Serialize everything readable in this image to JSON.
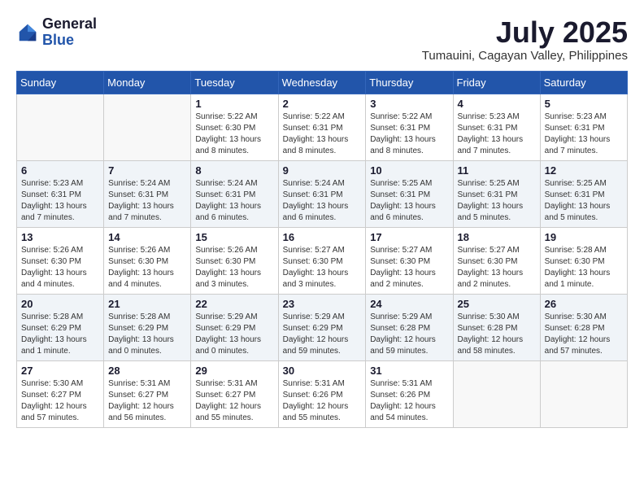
{
  "header": {
    "logo": {
      "general": "General",
      "blue": "Blue"
    },
    "title": "July 2025",
    "location": "Tumauini, Cagayan Valley, Philippines"
  },
  "weekdays": [
    "Sunday",
    "Monday",
    "Tuesday",
    "Wednesday",
    "Thursday",
    "Friday",
    "Saturday"
  ],
  "weeks": [
    [
      {
        "day": "",
        "sunrise": "",
        "sunset": "",
        "daylight": ""
      },
      {
        "day": "",
        "sunrise": "",
        "sunset": "",
        "daylight": ""
      },
      {
        "day": "1",
        "sunrise": "Sunrise: 5:22 AM",
        "sunset": "Sunset: 6:30 PM",
        "daylight": "Daylight: 13 hours and 8 minutes."
      },
      {
        "day": "2",
        "sunrise": "Sunrise: 5:22 AM",
        "sunset": "Sunset: 6:31 PM",
        "daylight": "Daylight: 13 hours and 8 minutes."
      },
      {
        "day": "3",
        "sunrise": "Sunrise: 5:22 AM",
        "sunset": "Sunset: 6:31 PM",
        "daylight": "Daylight: 13 hours and 8 minutes."
      },
      {
        "day": "4",
        "sunrise": "Sunrise: 5:23 AM",
        "sunset": "Sunset: 6:31 PM",
        "daylight": "Daylight: 13 hours and 7 minutes."
      },
      {
        "day": "5",
        "sunrise": "Sunrise: 5:23 AM",
        "sunset": "Sunset: 6:31 PM",
        "daylight": "Daylight: 13 hours and 7 minutes."
      }
    ],
    [
      {
        "day": "6",
        "sunrise": "Sunrise: 5:23 AM",
        "sunset": "Sunset: 6:31 PM",
        "daylight": "Daylight: 13 hours and 7 minutes."
      },
      {
        "day": "7",
        "sunrise": "Sunrise: 5:24 AM",
        "sunset": "Sunset: 6:31 PM",
        "daylight": "Daylight: 13 hours and 7 minutes."
      },
      {
        "day": "8",
        "sunrise": "Sunrise: 5:24 AM",
        "sunset": "Sunset: 6:31 PM",
        "daylight": "Daylight: 13 hours and 6 minutes."
      },
      {
        "day": "9",
        "sunrise": "Sunrise: 5:24 AM",
        "sunset": "Sunset: 6:31 PM",
        "daylight": "Daylight: 13 hours and 6 minutes."
      },
      {
        "day": "10",
        "sunrise": "Sunrise: 5:25 AM",
        "sunset": "Sunset: 6:31 PM",
        "daylight": "Daylight: 13 hours and 6 minutes."
      },
      {
        "day": "11",
        "sunrise": "Sunrise: 5:25 AM",
        "sunset": "Sunset: 6:31 PM",
        "daylight": "Daylight: 13 hours and 5 minutes."
      },
      {
        "day": "12",
        "sunrise": "Sunrise: 5:25 AM",
        "sunset": "Sunset: 6:31 PM",
        "daylight": "Daylight: 13 hours and 5 minutes."
      }
    ],
    [
      {
        "day": "13",
        "sunrise": "Sunrise: 5:26 AM",
        "sunset": "Sunset: 6:30 PM",
        "daylight": "Daylight: 13 hours and 4 minutes."
      },
      {
        "day": "14",
        "sunrise": "Sunrise: 5:26 AM",
        "sunset": "Sunset: 6:30 PM",
        "daylight": "Daylight: 13 hours and 4 minutes."
      },
      {
        "day": "15",
        "sunrise": "Sunrise: 5:26 AM",
        "sunset": "Sunset: 6:30 PM",
        "daylight": "Daylight: 13 hours and 3 minutes."
      },
      {
        "day": "16",
        "sunrise": "Sunrise: 5:27 AM",
        "sunset": "Sunset: 6:30 PM",
        "daylight": "Daylight: 13 hours and 3 minutes."
      },
      {
        "day": "17",
        "sunrise": "Sunrise: 5:27 AM",
        "sunset": "Sunset: 6:30 PM",
        "daylight": "Daylight: 13 hours and 2 minutes."
      },
      {
        "day": "18",
        "sunrise": "Sunrise: 5:27 AM",
        "sunset": "Sunset: 6:30 PM",
        "daylight": "Daylight: 13 hours and 2 minutes."
      },
      {
        "day": "19",
        "sunrise": "Sunrise: 5:28 AM",
        "sunset": "Sunset: 6:30 PM",
        "daylight": "Daylight: 13 hours and 1 minute."
      }
    ],
    [
      {
        "day": "20",
        "sunrise": "Sunrise: 5:28 AM",
        "sunset": "Sunset: 6:29 PM",
        "daylight": "Daylight: 13 hours and 1 minute."
      },
      {
        "day": "21",
        "sunrise": "Sunrise: 5:28 AM",
        "sunset": "Sunset: 6:29 PM",
        "daylight": "Daylight: 13 hours and 0 minutes."
      },
      {
        "day": "22",
        "sunrise": "Sunrise: 5:29 AM",
        "sunset": "Sunset: 6:29 PM",
        "daylight": "Daylight: 13 hours and 0 minutes."
      },
      {
        "day": "23",
        "sunrise": "Sunrise: 5:29 AM",
        "sunset": "Sunset: 6:29 PM",
        "daylight": "Daylight: 12 hours and 59 minutes."
      },
      {
        "day": "24",
        "sunrise": "Sunrise: 5:29 AM",
        "sunset": "Sunset: 6:28 PM",
        "daylight": "Daylight: 12 hours and 59 minutes."
      },
      {
        "day": "25",
        "sunrise": "Sunrise: 5:30 AM",
        "sunset": "Sunset: 6:28 PM",
        "daylight": "Daylight: 12 hours and 58 minutes."
      },
      {
        "day": "26",
        "sunrise": "Sunrise: 5:30 AM",
        "sunset": "Sunset: 6:28 PM",
        "daylight": "Daylight: 12 hours and 57 minutes."
      }
    ],
    [
      {
        "day": "27",
        "sunrise": "Sunrise: 5:30 AM",
        "sunset": "Sunset: 6:27 PM",
        "daylight": "Daylight: 12 hours and 57 minutes."
      },
      {
        "day": "28",
        "sunrise": "Sunrise: 5:31 AM",
        "sunset": "Sunset: 6:27 PM",
        "daylight": "Daylight: 12 hours and 56 minutes."
      },
      {
        "day": "29",
        "sunrise": "Sunrise: 5:31 AM",
        "sunset": "Sunset: 6:27 PM",
        "daylight": "Daylight: 12 hours and 55 minutes."
      },
      {
        "day": "30",
        "sunrise": "Sunrise: 5:31 AM",
        "sunset": "Sunset: 6:26 PM",
        "daylight": "Daylight: 12 hours and 55 minutes."
      },
      {
        "day": "31",
        "sunrise": "Sunrise: 5:31 AM",
        "sunset": "Sunset: 6:26 PM",
        "daylight": "Daylight: 12 hours and 54 minutes."
      },
      {
        "day": "",
        "sunrise": "",
        "sunset": "",
        "daylight": ""
      },
      {
        "day": "",
        "sunrise": "",
        "sunset": "",
        "daylight": ""
      }
    ]
  ]
}
